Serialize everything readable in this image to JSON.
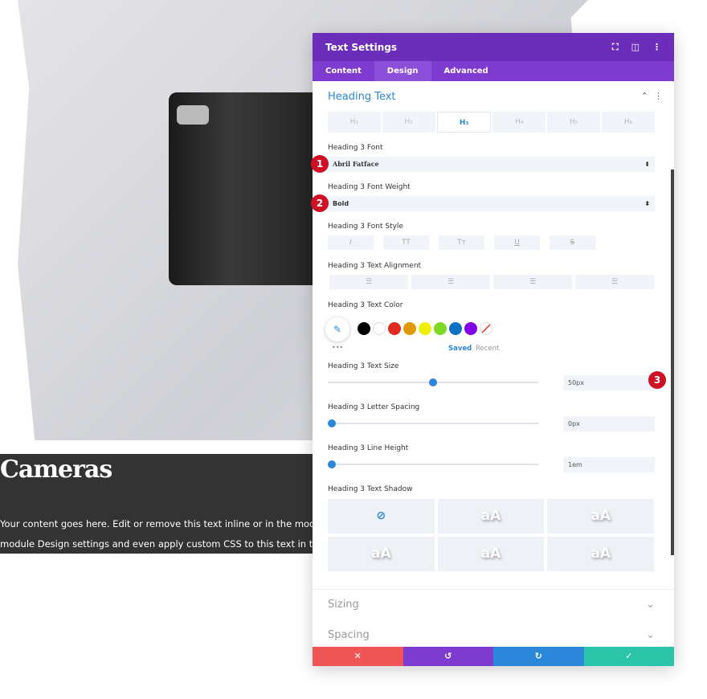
{
  "page": {
    "heading": "Cameras",
    "body_line1": "Your content goes here. Edit or remove this text inline or in the module Content settings. You can also style every aspect of this content in the",
    "body_line2": "module Design settings and even apply custom CSS to this text in the module Advanced settings."
  },
  "panel": {
    "title": "Text Settings",
    "tabs": [
      "Content",
      "Design",
      "Advanced"
    ],
    "active_tab": "Design",
    "section_title": "Heading Text",
    "heading_tabs": [
      "H₁",
      "H₂",
      "H₃",
      "H₄",
      "H₅",
      "H₆"
    ],
    "font_label": "Heading 3 Font",
    "font_value": "Abril Fatface",
    "weight_label": "Heading 3 Font Weight",
    "weight_value": "Bold",
    "style_label": "Heading 3 Font Style",
    "style_buttons": [
      "I",
      "TT",
      "Tт",
      "U",
      "S"
    ],
    "align_label": "Heading 3 Text Alignment",
    "color_label": "Heading 3 Text Color",
    "swatches": [
      "#000000",
      "#ffffff",
      "#e02b20",
      "#e09900",
      "#edf000",
      "#7cda24",
      "#0c71c3",
      "#8300e9"
    ],
    "saved": "Saved",
    "recent": "Recent",
    "more": "•••",
    "size_label": "Heading 3 Text Size",
    "size_value": "50px",
    "size_fraction": 0.5,
    "spacing_label": "Heading 3 Letter Spacing",
    "spacing_value": "0px",
    "lineheight_label": "Heading 3 Line Height",
    "lineheight_value": "1em",
    "shadow_label": "Heading 3 Text Shadow",
    "shadow_sample": "aA",
    "sizing": "Sizing",
    "spacing": "Spacing"
  },
  "markers": [
    "1",
    "2",
    "3"
  ],
  "footer_colors": [
    "#ef5555",
    "#7e3bd0",
    "#2b87da",
    "#29c4a9"
  ]
}
